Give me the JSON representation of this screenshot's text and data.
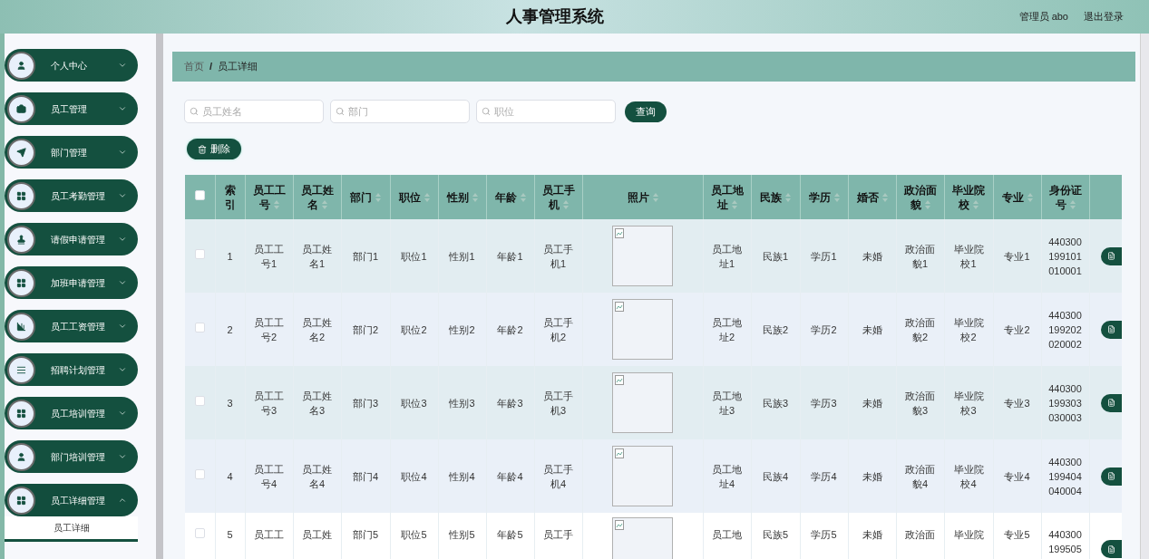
{
  "header": {
    "title": "人事管理系统",
    "user": "管理员 abo",
    "logout": "退出登录"
  },
  "sidebar": {
    "items": [
      {
        "label": "个人中心",
        "expanded": false
      },
      {
        "label": "员工管理",
        "expanded": false
      },
      {
        "label": "部门管理",
        "expanded": false
      },
      {
        "label": "员工考勤管理",
        "expanded": false
      },
      {
        "label": "请假申请管理",
        "expanded": false
      },
      {
        "label": "加班申请管理",
        "expanded": false
      },
      {
        "label": "员工工资管理",
        "expanded": false
      },
      {
        "label": "招聘计划管理",
        "expanded": false
      },
      {
        "label": "员工培训管理",
        "expanded": false
      },
      {
        "label": "部门培训管理",
        "expanded": false
      },
      {
        "label": "员工详细管理",
        "expanded": true,
        "children": [
          {
            "label": "员工详细"
          }
        ]
      }
    ]
  },
  "breadcrumb": {
    "links": [
      "首页",
      "员工详细"
    ],
    "separator": "/"
  },
  "search": {
    "fields": [
      {
        "placeholder": "员工姓名"
      },
      {
        "placeholder": "部门"
      },
      {
        "placeholder": "职位"
      }
    ],
    "button": "查询"
  },
  "delete_button": "删除",
  "table": {
    "header_checked": false,
    "columns": [
      {
        "label": "索引",
        "sortable": false
      },
      {
        "label": "员工工号",
        "sortable": true
      },
      {
        "label": "员工姓名",
        "sortable": true
      },
      {
        "label": "部门",
        "sortable": true
      },
      {
        "label": "职位",
        "sortable": true
      },
      {
        "label": "性别",
        "sortable": true
      },
      {
        "label": "年龄",
        "sortable": true
      },
      {
        "label": "员工手机",
        "sortable": true
      },
      {
        "label": "照片",
        "sortable": true
      },
      {
        "label": "员工地址",
        "sortable": true
      },
      {
        "label": "民族",
        "sortable": true
      },
      {
        "label": "学历",
        "sortable": true
      },
      {
        "label": "婚否",
        "sortable": true
      },
      {
        "label": "政治面貌",
        "sortable": true
      },
      {
        "label": "毕业院校",
        "sortable": true
      },
      {
        "label": "专业",
        "sortable": true
      },
      {
        "label": "身份证号",
        "sortable": true
      }
    ],
    "rows": [
      {
        "checked": false,
        "cells": [
          "1",
          "员工工号1",
          "员工姓名1",
          "部门1",
          "职位1",
          "性别1",
          "年龄1",
          "员工手机1",
          "",
          "员工地址1",
          "民族1",
          "学历1",
          "未婚",
          "政治面貌1",
          "毕业院校1",
          "专业1",
          "440300199101010001"
        ]
      },
      {
        "checked": false,
        "cells": [
          "2",
          "员工工号2",
          "员工姓名2",
          "部门2",
          "职位2",
          "性别2",
          "年龄2",
          "员工手机2",
          "",
          "员工地址2",
          "民族2",
          "学历2",
          "未婚",
          "政治面貌2",
          "毕业院校2",
          "专业2",
          "440300199202020002"
        ]
      },
      {
        "checked": false,
        "cells": [
          "3",
          "员工工号3",
          "员工姓名3",
          "部门3",
          "职位3",
          "性别3",
          "年龄3",
          "员工手机3",
          "",
          "员工地址3",
          "民族3",
          "学历3",
          "未婚",
          "政治面貌3",
          "毕业院校3",
          "专业3",
          "440300199303030003"
        ]
      },
      {
        "checked": false,
        "cells": [
          "4",
          "员工工号4",
          "员工姓名4",
          "部门4",
          "职位4",
          "性别4",
          "年龄4",
          "员工手机4",
          "",
          "员工地址4",
          "民族4",
          "学历4",
          "未婚",
          "政治面貌4",
          "毕业院校4",
          "专业4",
          "440300199404040004"
        ]
      },
      {
        "checked": false,
        "cells": [
          "5",
          "员工工",
          "员工姓",
          "部门5",
          "职位5",
          "性别5",
          "年龄5",
          "员工手",
          "",
          "员工地",
          "民族5",
          "学历5",
          "未婚",
          "政治面",
          "毕业院",
          "专业5",
          "440300199505"
        ]
      }
    ]
  }
}
